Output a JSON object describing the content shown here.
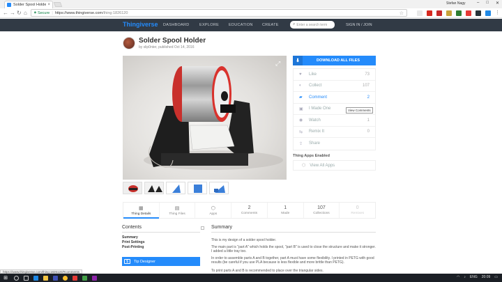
{
  "browser": {
    "tab_title": "Solder Spool Holder by ...",
    "tab_close": "×",
    "user": "Stefan Nagy",
    "secure_label": "Secure",
    "url_host": "https://www.thingiverse.com",
    "url_path": "/thing:1826120",
    "status_url": "https://www.thingiverse.com/thing:1826120/#comments"
  },
  "site": {
    "logo": "Thingiverse",
    "nav": [
      "DASHBOARD",
      "EXPLORE",
      "EDUCATION",
      "CREATE"
    ],
    "search_placeholder": "Enter a search term",
    "signin": "SIGN IN / JOIN"
  },
  "thing": {
    "title": "Solder Spool Holder",
    "byline": "by slip0nter, published Oct 14, 2016"
  },
  "download_label": "DOWNLOAD ALL FILES",
  "actions": [
    {
      "icon": "heart-icon",
      "glyph": "♥",
      "label": "Like",
      "count": "73",
      "highlight": false
    },
    {
      "icon": "collect-icon",
      "glyph": "◐",
      "label": "Collect",
      "count": "107",
      "highlight": false
    },
    {
      "icon": "comment-icon",
      "glyph": "▰",
      "label": "Comment",
      "count": "2",
      "highlight": true
    },
    {
      "icon": "made-icon",
      "glyph": "▣",
      "label": "I Made One",
      "count": "",
      "highlight": false
    },
    {
      "icon": "watch-icon",
      "glyph": "◉",
      "label": "Watch",
      "count": "1",
      "highlight": false
    },
    {
      "icon": "remix-icon",
      "glyph": "⇆",
      "label": "Remix It",
      "count": "0",
      "highlight": false
    },
    {
      "icon": "share-icon",
      "glyph": "⇪",
      "label": "Share",
      "count": "",
      "highlight": false
    }
  ],
  "tooltip": "View Comments",
  "apps": {
    "title": "Thing Apps Enabled",
    "view_all": "View All Apps"
  },
  "tabs": [
    {
      "name": "tab-thing-details",
      "icon": "▦",
      "value": "",
      "label": "Thing Details",
      "active": true,
      "dim": false
    },
    {
      "name": "tab-thing-files",
      "icon": "▤",
      "value": "",
      "label": "Thing Files",
      "active": false,
      "dim": false
    },
    {
      "name": "tab-apps",
      "icon": "⬡",
      "value": "",
      "label": "Apps",
      "active": false,
      "dim": false
    },
    {
      "name": "tab-comments",
      "icon": "",
      "value": "2",
      "label": "Comments",
      "active": false,
      "dim": false
    },
    {
      "name": "tab-made",
      "icon": "",
      "value": "1",
      "label": "Made",
      "active": false,
      "dim": false
    },
    {
      "name": "tab-collections",
      "icon": "",
      "value": "107",
      "label": "Collections",
      "active": false,
      "dim": false
    },
    {
      "name": "tab-remixes",
      "icon": "",
      "value": "0",
      "label": "Remixes",
      "active": false,
      "dim": true
    }
  ],
  "contents": {
    "heading": "Contents",
    "links": [
      "Summary",
      "Print Settings",
      "Post-Printing"
    ],
    "tip_label": "Tip Designer"
  },
  "summary": {
    "heading": "Summary",
    "paragraphs": [
      "This is my design of a solder spool holder.",
      "The main part is \"part A\" which holds the spool, \"part B\" is used to close the structure and make it stronger. I added a little tray too.",
      "In order to assemble parts A and B together, part A must have some flexibility. I printed in PETG with good results (be careful if you use PLA because is less flexible and more brittle than PETG).",
      "To print parts A and B is recommended to place over the triangular sides."
    ]
  },
  "taskbar": {
    "lang": "ENG",
    "time": "20:09"
  }
}
